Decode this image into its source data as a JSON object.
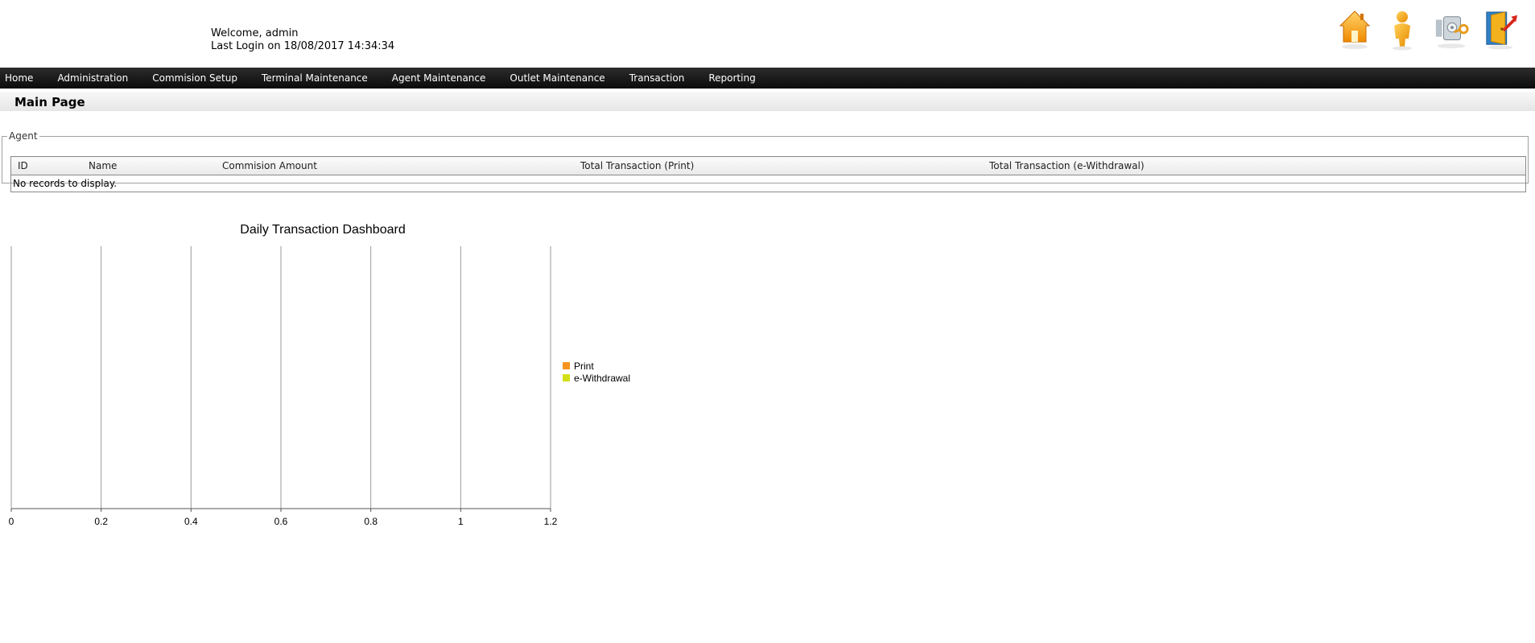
{
  "header": {
    "welcome_text": "Welcome, admin",
    "last_login_text": "Last Login on 18/08/2017 14:34:34",
    "icons": [
      "home-icon",
      "user-icon",
      "keys-icon",
      "logout-icon"
    ]
  },
  "nav": {
    "items": [
      "Home",
      "Administration",
      "Commision Setup",
      "Terminal Maintenance",
      "Agent Maintenance",
      "Outlet Maintenance",
      "Transaction",
      "Reporting"
    ]
  },
  "page": {
    "title": "Main Page"
  },
  "agent": {
    "legend": "Agent",
    "columns": [
      "ID",
      "Name",
      "Commision Amount",
      "Total Transaction (Print)",
      "Total Transaction (e-Withdrawal)"
    ],
    "empty_message": "No records to display."
  },
  "chart_data": {
    "type": "bar",
    "orientation": "horizontal",
    "title": "Daily Transaction Dashboard",
    "categories": [],
    "series": [
      {
        "name": "Print",
        "values": [],
        "color": "#f7941d"
      },
      {
        "name": "e-Withdrawal",
        "values": [],
        "color": "#d4e017"
      }
    ],
    "x_ticks": [
      "0",
      "0.2",
      "0.4",
      "0.6",
      "0.8",
      "1",
      "1.2"
    ],
    "xlim": [
      0,
      1.2
    ],
    "grid": true,
    "legend_position": "right"
  },
  "colors": {
    "navbar": "#1a1a1a",
    "nav_text": "#ffffff"
  }
}
